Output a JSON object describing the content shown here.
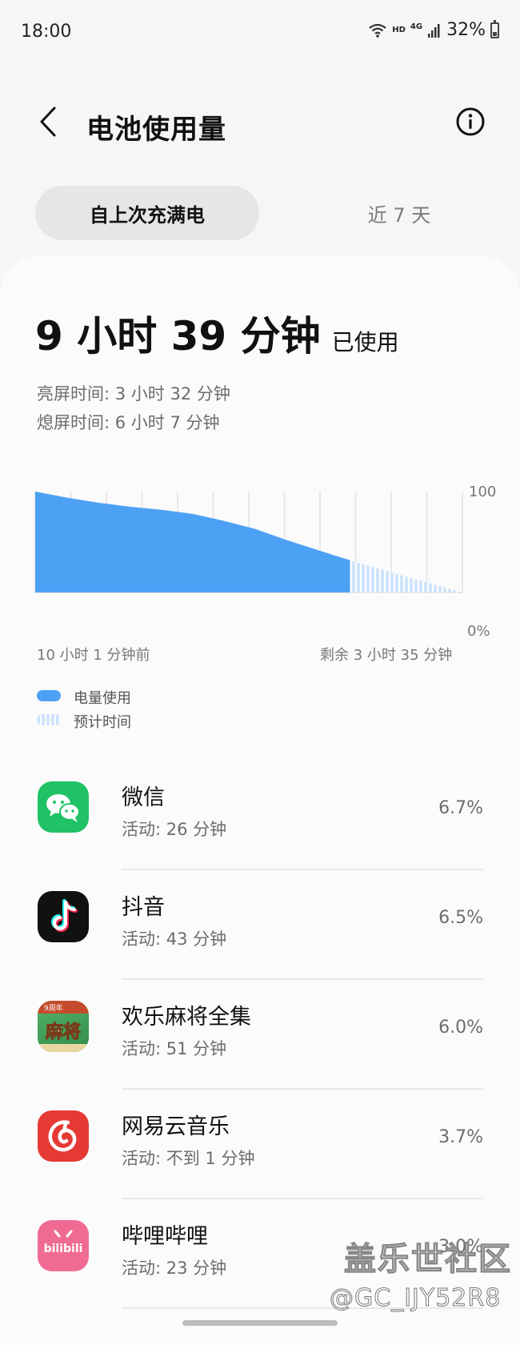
{
  "status_bar": {
    "time": "18:00",
    "wifi_icon": "wifi-icon",
    "hd_label": "HD",
    "network_label": "4G",
    "battery_percent": "32%"
  },
  "header": {
    "title": "电池使用量",
    "back_icon": "chevron-left-icon",
    "info_icon": "info-icon"
  },
  "tabs": [
    {
      "label": "自上次充满电",
      "active": true
    },
    {
      "label": "近 7 天",
      "active": false
    }
  ],
  "usage": {
    "total": "9 小时 39 分钟",
    "suffix": "已使用",
    "screen_on": "亮屏时间:  3 小时 32 分钟",
    "screen_off": "熄屏时间:  6 小时 7 分钟"
  },
  "chart_data": {
    "type": "area",
    "x_start_label": "10 小时 1 分钟前",
    "x_end_label": "剩余 3 小时 35 分钟",
    "y_top_label": "100",
    "y_bottom_label": "0%",
    "ylim": [
      0,
      100
    ],
    "x_hours": [
      0,
      0.5,
      1,
      2,
      3,
      4,
      5,
      6,
      7,
      8,
      9,
      9.5,
      10.02,
      11,
      12,
      13.6
    ],
    "usage_series": [
      100,
      97,
      94,
      89,
      85,
      82,
      78,
      71,
      63,
      52,
      42,
      37,
      32,
      null,
      null,
      null
    ],
    "projected_series": [
      null,
      null,
      null,
      null,
      null,
      null,
      null,
      null,
      null,
      null,
      null,
      null,
      32,
      23,
      14,
      0
    ],
    "legend": [
      "电量使用",
      "预计时间"
    ],
    "colors": {
      "usage": "#4da1f5",
      "projected": "#bcdaf8"
    }
  },
  "apps": [
    {
      "name": "微信",
      "activity": "活动:  26 分钟",
      "percent": "6.7%",
      "icon": "wechat-icon",
      "color": "#1fc265"
    },
    {
      "name": "抖音",
      "activity": "活动:  43 分钟",
      "percent": "6.5%",
      "icon": "douyin-icon",
      "color": "#111111"
    },
    {
      "name": "欢乐麻将全集",
      "activity": "活动:  51 分钟",
      "percent": "6.0%",
      "icon": "mahjong-icon",
      "color": "#2f8b4a"
    },
    {
      "name": "网易云音乐",
      "activity": "活动:  不到 1 分钟",
      "percent": "3.7%",
      "icon": "netease-music-icon",
      "color": "#e53935"
    },
    {
      "name": "哔哩哔哩",
      "activity": "活动:  23 分钟",
      "percent": "3.0%",
      "icon": "bilibili-icon",
      "color": "#f06b94"
    }
  ],
  "mahjong_icon_text": "麻将",
  "mahjong_badge_text": "9周年",
  "bilibili_icon_text": "bilibili",
  "watermark": {
    "site": "盖乐世社区",
    "user": "@GC_IJY52R8"
  }
}
